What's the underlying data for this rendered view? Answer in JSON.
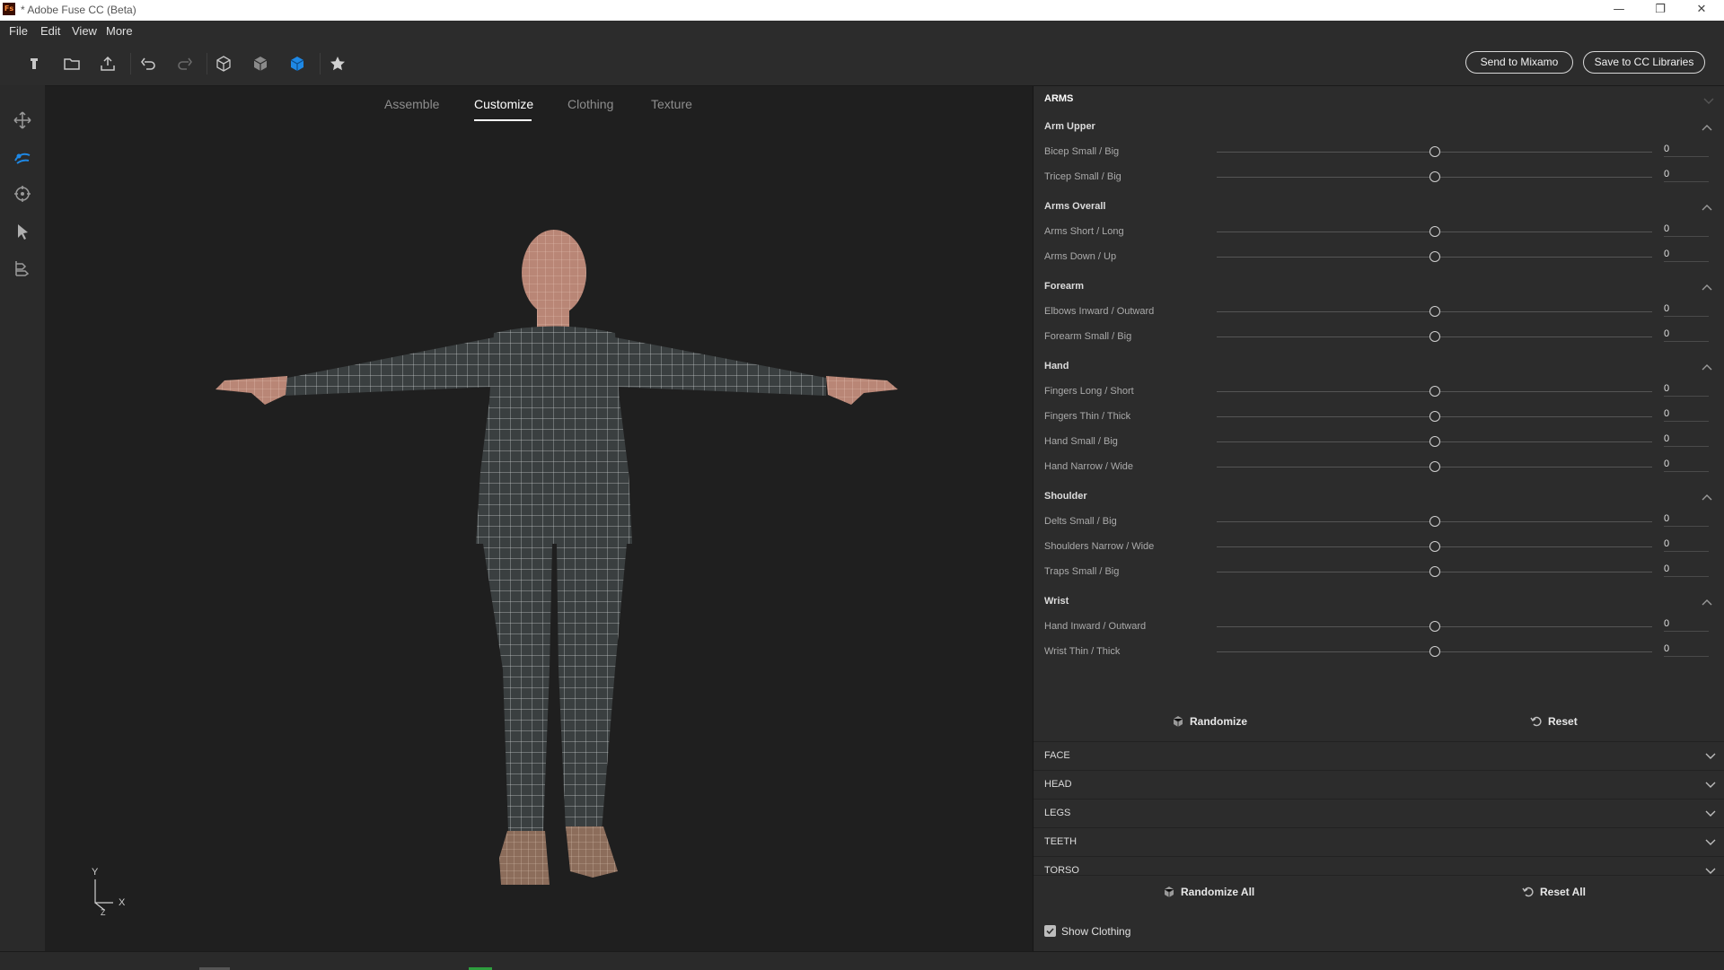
{
  "window": {
    "app_icon_text": "Fs",
    "title": "* Adobe Fuse CC (Beta)",
    "minimize": "—",
    "maximize": "❐",
    "close": "✕"
  },
  "menu": {
    "items": [
      "File",
      "Edit",
      "View",
      "More"
    ]
  },
  "toolbar": {
    "send_to_mixamo": "Send to Mixamo",
    "save_to_cc": "Save to CC Libraries"
  },
  "tabs": {
    "items": [
      "Assemble",
      "Customize",
      "Clothing",
      "Texture"
    ],
    "active": "Customize"
  },
  "viewport": {
    "axis_y": "Y",
    "axis_x": "X",
    "axis_z": "Z"
  },
  "panel": {
    "section": "ARMS",
    "groups": [
      {
        "title": "Arm Upper",
        "rows": [
          {
            "label": "Bicep Small / Big",
            "value": "0"
          },
          {
            "label": "Tricep Small / Big",
            "value": "0"
          }
        ]
      },
      {
        "title": "Arms Overall",
        "rows": [
          {
            "label": "Arms Short / Long",
            "value": "0"
          },
          {
            "label": "Arms Down / Up",
            "value": "0"
          }
        ]
      },
      {
        "title": "Forearm",
        "rows": [
          {
            "label": "Elbows Inward / Outward",
            "value": "0"
          },
          {
            "label": "Forearm Small / Big",
            "value": "0"
          }
        ]
      },
      {
        "title": "Hand",
        "rows": [
          {
            "label": "Fingers Long / Short",
            "value": "0"
          },
          {
            "label": "Fingers Thin / Thick",
            "value": "0"
          },
          {
            "label": "Hand Small / Big",
            "value": "0"
          },
          {
            "label": "Hand Narrow / Wide",
            "value": "0"
          }
        ]
      },
      {
        "title": "Shoulder",
        "rows": [
          {
            "label": "Delts Small / Big",
            "value": "0"
          },
          {
            "label": "Shoulders Narrow / Wide",
            "value": "0"
          },
          {
            "label": "Traps Small / Big",
            "value": "0"
          }
        ]
      },
      {
        "title": "Wrist",
        "rows": [
          {
            "label": "Hand Inward / Outward",
            "value": "0"
          },
          {
            "label": "Wrist Thin / Thick",
            "value": "0"
          }
        ]
      }
    ],
    "slider_level": 0.5,
    "randomize": "Randomize",
    "reset": "Reset",
    "collapsed_sections": [
      "FACE",
      "HEAD",
      "LEGS",
      "TEETH",
      "TORSO"
    ],
    "randomize_all": "Randomize All",
    "reset_all": "Reset All",
    "show_clothing": "Show Clothing",
    "show_clothing_checked": true
  },
  "colors": {
    "accent": "#1e88e5",
    "status_green": "#2e9e3e"
  }
}
